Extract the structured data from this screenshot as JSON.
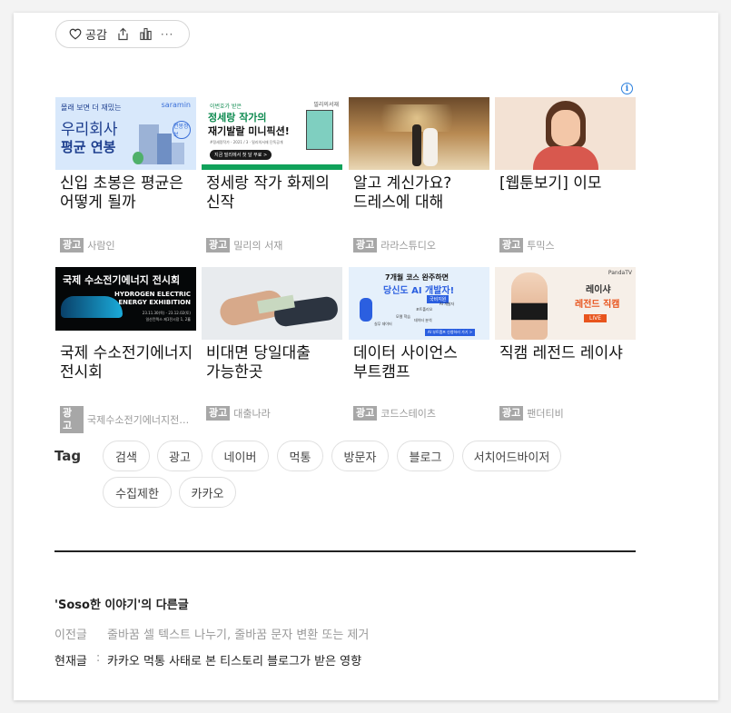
{
  "actions": {
    "like_label": "공감",
    "more_label": "···"
  },
  "ad_info_symbol": "i",
  "ads": [
    {
      "title": "신입 초봉은 평균은 어떻게 될까",
      "badge": "광고",
      "source": "사람인",
      "thumb": {
        "brand": "saramin",
        "line1": "몰래 보면 더 재밌는",
        "line2": "우리회사",
        "line3": "평균 연봉",
        "stamp": "연봉정보"
      }
    },
    {
      "title": "정세랑 작가 화제의 신작",
      "badge": "광고",
      "source": "밀리의 서재",
      "thumb": {
        "top": "이번호가 받은",
        "line1": "정세랑 작가의",
        "line2": "재기발랄 미니픽션!",
        "sub": "#정세랑작가 - 2021 / 3 · 밀리의서재 단독공개",
        "cta": "지금 밀리에서 첫 달 무료 >",
        "brand": "밀리의서재"
      }
    },
    {
      "title": "알고 계신가요? 드레스에 대해",
      "badge": "광고",
      "source": "라라스튜디오",
      "thumb": {}
    },
    {
      "title": "[웹툰보기] 이모",
      "badge": "광고",
      "source": "투믹스",
      "thumb": {}
    },
    {
      "title": "국제 수소전기에너지 전시회",
      "badge": "광고",
      "source": "국제수소전기에너지전시회",
      "thumb": {
        "line1": "국제 수소전기에너지 전시회",
        "line2": "HYDROGEN ELECTRIC",
        "line3": "ENERGY EXHIBITION",
        "date": "23.11.30(목) - 23.12.02(토)",
        "venue": "일산킨텍스 제1전시장 1, 2홀"
      }
    },
    {
      "title": "비대면 당일대출 가능한곳",
      "badge": "광고",
      "source": "대출나라",
      "thumb": {}
    },
    {
      "title": "데이터 사이언스 부트캠프",
      "badge": "광고",
      "source": "코드스테이츠",
      "thumb": {
        "line1": "7개월 코스 완주하면",
        "line2": "당신도 AI 개발자!",
        "line3": "국비지원",
        "cta": "AI 부트캠프 신청하러 가기 >",
        "steps": [
          "실무 데이터",
          "모델 학습",
          "포트폴리오",
          "AI 개발자",
          "데이터 분석"
        ]
      }
    },
    {
      "title": "직캠 레전드 레이샤",
      "badge": "광고",
      "source": "팬더티비",
      "thumb": {
        "brand": "PandaTV",
        "line1": "레이샤",
        "line2": "레전드 직캠",
        "cta": "LIVE"
      }
    }
  ],
  "tags": {
    "label": "Tag",
    "items": [
      "검색",
      "광고",
      "네이버",
      "먹통",
      "방문자",
      "블로그",
      "서치어드바이저",
      "수집제한",
      "카카오"
    ]
  },
  "other_posts": {
    "title": "'Soso한 이야기'의 다른글",
    "prev_label": "이전글",
    "prev_title": "줄바꿈 셀 텍스트 나누기, 줄바꿈 문자 변환 또는 제거",
    "current_label": "현재글",
    "current_sep": ":",
    "current_title": "카카오 먹통 사태로 본 티스토리 블로그가 받은 영향"
  },
  "colors": {
    "accent_blue": "#2a7fde",
    "badge_gray": "#a7a7a7",
    "divider": "#222222"
  }
}
